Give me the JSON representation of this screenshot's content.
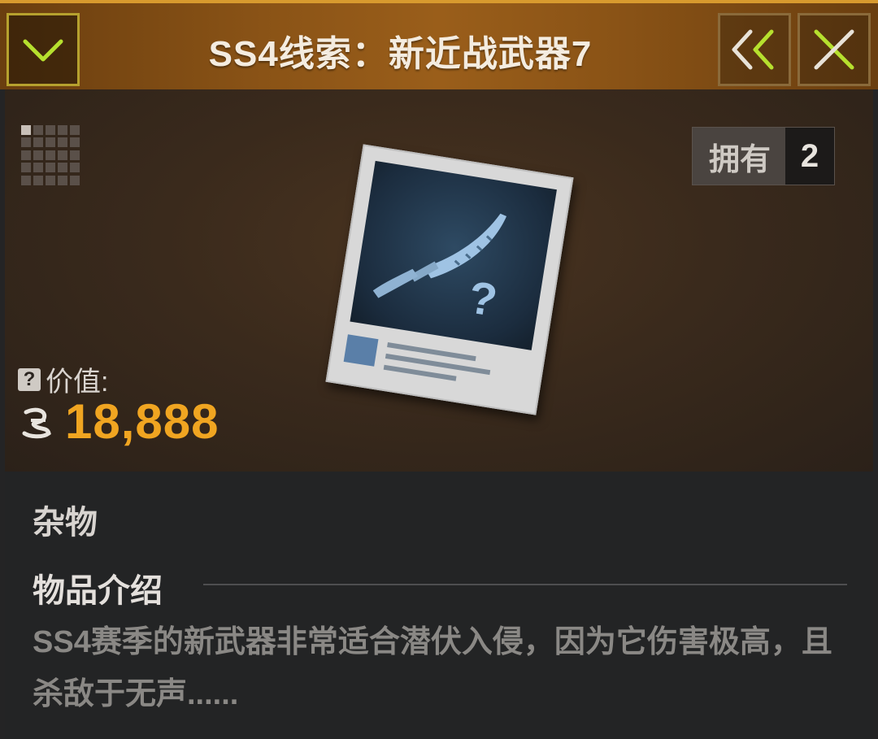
{
  "header": {
    "title": "SS4线索：新近战武器7",
    "collapse_icon": "chevron-down-icon",
    "back_icon": "double-chevron-left-icon",
    "close_icon": "close-icon"
  },
  "item": {
    "owned_label": "拥有",
    "owned_count": "2",
    "value_label": "价值:",
    "value": "18,888",
    "currency_icon": "coin-icon",
    "category": "杂物",
    "intro_heading": "物品介绍",
    "intro_text": "SS4赛季的新武器非常适合潜伏入侵，因为它伤害极高，且杀敌于无声......"
  },
  "colors": {
    "header_accent": "#d89a2e",
    "value": "#f0a521",
    "icon_green": "#b6e02e"
  }
}
